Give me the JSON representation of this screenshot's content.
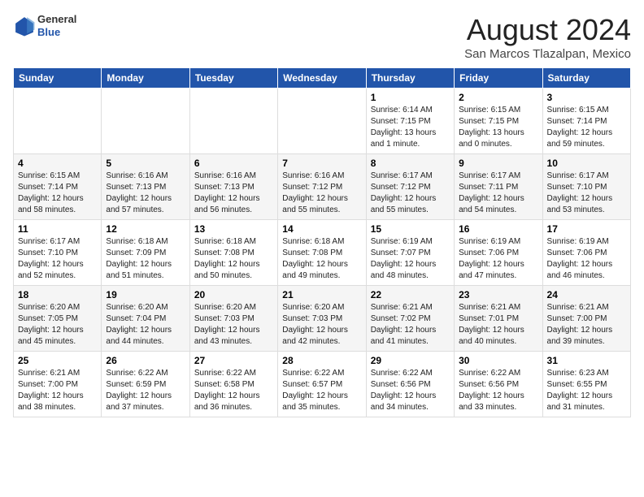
{
  "header": {
    "logo": {
      "line1": "General",
      "line2": "Blue"
    },
    "title": "August 2024",
    "subtitle": "San Marcos Tlazalpan, Mexico"
  },
  "weekdays": [
    "Sunday",
    "Monday",
    "Tuesday",
    "Wednesday",
    "Thursday",
    "Friday",
    "Saturday"
  ],
  "weeks": [
    [
      {
        "day": "",
        "sunrise": "",
        "sunset": "",
        "daylight": ""
      },
      {
        "day": "",
        "sunrise": "",
        "sunset": "",
        "daylight": ""
      },
      {
        "day": "",
        "sunrise": "",
        "sunset": "",
        "daylight": ""
      },
      {
        "day": "",
        "sunrise": "",
        "sunset": "",
        "daylight": ""
      },
      {
        "day": "1",
        "sunrise": "Sunrise: 6:14 AM",
        "sunset": "Sunset: 7:15 PM",
        "daylight": "Daylight: 13 hours and 1 minute."
      },
      {
        "day": "2",
        "sunrise": "Sunrise: 6:15 AM",
        "sunset": "Sunset: 7:15 PM",
        "daylight": "Daylight: 13 hours and 0 minutes."
      },
      {
        "day": "3",
        "sunrise": "Sunrise: 6:15 AM",
        "sunset": "Sunset: 7:14 PM",
        "daylight": "Daylight: 12 hours and 59 minutes."
      }
    ],
    [
      {
        "day": "4",
        "sunrise": "Sunrise: 6:15 AM",
        "sunset": "Sunset: 7:14 PM",
        "daylight": "Daylight: 12 hours and 58 minutes."
      },
      {
        "day": "5",
        "sunrise": "Sunrise: 6:16 AM",
        "sunset": "Sunset: 7:13 PM",
        "daylight": "Daylight: 12 hours and 57 minutes."
      },
      {
        "day": "6",
        "sunrise": "Sunrise: 6:16 AM",
        "sunset": "Sunset: 7:13 PM",
        "daylight": "Daylight: 12 hours and 56 minutes."
      },
      {
        "day": "7",
        "sunrise": "Sunrise: 6:16 AM",
        "sunset": "Sunset: 7:12 PM",
        "daylight": "Daylight: 12 hours and 55 minutes."
      },
      {
        "day": "8",
        "sunrise": "Sunrise: 6:17 AM",
        "sunset": "Sunset: 7:12 PM",
        "daylight": "Daylight: 12 hours and 55 minutes."
      },
      {
        "day": "9",
        "sunrise": "Sunrise: 6:17 AM",
        "sunset": "Sunset: 7:11 PM",
        "daylight": "Daylight: 12 hours and 54 minutes."
      },
      {
        "day": "10",
        "sunrise": "Sunrise: 6:17 AM",
        "sunset": "Sunset: 7:10 PM",
        "daylight": "Daylight: 12 hours and 53 minutes."
      }
    ],
    [
      {
        "day": "11",
        "sunrise": "Sunrise: 6:17 AM",
        "sunset": "Sunset: 7:10 PM",
        "daylight": "Daylight: 12 hours and 52 minutes."
      },
      {
        "day": "12",
        "sunrise": "Sunrise: 6:18 AM",
        "sunset": "Sunset: 7:09 PM",
        "daylight": "Daylight: 12 hours and 51 minutes."
      },
      {
        "day": "13",
        "sunrise": "Sunrise: 6:18 AM",
        "sunset": "Sunset: 7:08 PM",
        "daylight": "Daylight: 12 hours and 50 minutes."
      },
      {
        "day": "14",
        "sunrise": "Sunrise: 6:18 AM",
        "sunset": "Sunset: 7:08 PM",
        "daylight": "Daylight: 12 hours and 49 minutes."
      },
      {
        "day": "15",
        "sunrise": "Sunrise: 6:19 AM",
        "sunset": "Sunset: 7:07 PM",
        "daylight": "Daylight: 12 hours and 48 minutes."
      },
      {
        "day": "16",
        "sunrise": "Sunrise: 6:19 AM",
        "sunset": "Sunset: 7:06 PM",
        "daylight": "Daylight: 12 hours and 47 minutes."
      },
      {
        "day": "17",
        "sunrise": "Sunrise: 6:19 AM",
        "sunset": "Sunset: 7:06 PM",
        "daylight": "Daylight: 12 hours and 46 minutes."
      }
    ],
    [
      {
        "day": "18",
        "sunrise": "Sunrise: 6:20 AM",
        "sunset": "Sunset: 7:05 PM",
        "daylight": "Daylight: 12 hours and 45 minutes."
      },
      {
        "day": "19",
        "sunrise": "Sunrise: 6:20 AM",
        "sunset": "Sunset: 7:04 PM",
        "daylight": "Daylight: 12 hours and 44 minutes."
      },
      {
        "day": "20",
        "sunrise": "Sunrise: 6:20 AM",
        "sunset": "Sunset: 7:03 PM",
        "daylight": "Daylight: 12 hours and 43 minutes."
      },
      {
        "day": "21",
        "sunrise": "Sunrise: 6:20 AM",
        "sunset": "Sunset: 7:03 PM",
        "daylight": "Daylight: 12 hours and 42 minutes."
      },
      {
        "day": "22",
        "sunrise": "Sunrise: 6:21 AM",
        "sunset": "Sunset: 7:02 PM",
        "daylight": "Daylight: 12 hours and 41 minutes."
      },
      {
        "day": "23",
        "sunrise": "Sunrise: 6:21 AM",
        "sunset": "Sunset: 7:01 PM",
        "daylight": "Daylight: 12 hours and 40 minutes."
      },
      {
        "day": "24",
        "sunrise": "Sunrise: 6:21 AM",
        "sunset": "Sunset: 7:00 PM",
        "daylight": "Daylight: 12 hours and 39 minutes."
      }
    ],
    [
      {
        "day": "25",
        "sunrise": "Sunrise: 6:21 AM",
        "sunset": "Sunset: 7:00 PM",
        "daylight": "Daylight: 12 hours and 38 minutes."
      },
      {
        "day": "26",
        "sunrise": "Sunrise: 6:22 AM",
        "sunset": "Sunset: 6:59 PM",
        "daylight": "Daylight: 12 hours and 37 minutes."
      },
      {
        "day": "27",
        "sunrise": "Sunrise: 6:22 AM",
        "sunset": "Sunset: 6:58 PM",
        "daylight": "Daylight: 12 hours and 36 minutes."
      },
      {
        "day": "28",
        "sunrise": "Sunrise: 6:22 AM",
        "sunset": "Sunset: 6:57 PM",
        "daylight": "Daylight: 12 hours and 35 minutes."
      },
      {
        "day": "29",
        "sunrise": "Sunrise: 6:22 AM",
        "sunset": "Sunset: 6:56 PM",
        "daylight": "Daylight: 12 hours and 34 minutes."
      },
      {
        "day": "30",
        "sunrise": "Sunrise: 6:22 AM",
        "sunset": "Sunset: 6:56 PM",
        "daylight": "Daylight: 12 hours and 33 minutes."
      },
      {
        "day": "31",
        "sunrise": "Sunrise: 6:23 AM",
        "sunset": "Sunset: 6:55 PM",
        "daylight": "Daylight: 12 hours and 31 minutes."
      }
    ]
  ]
}
